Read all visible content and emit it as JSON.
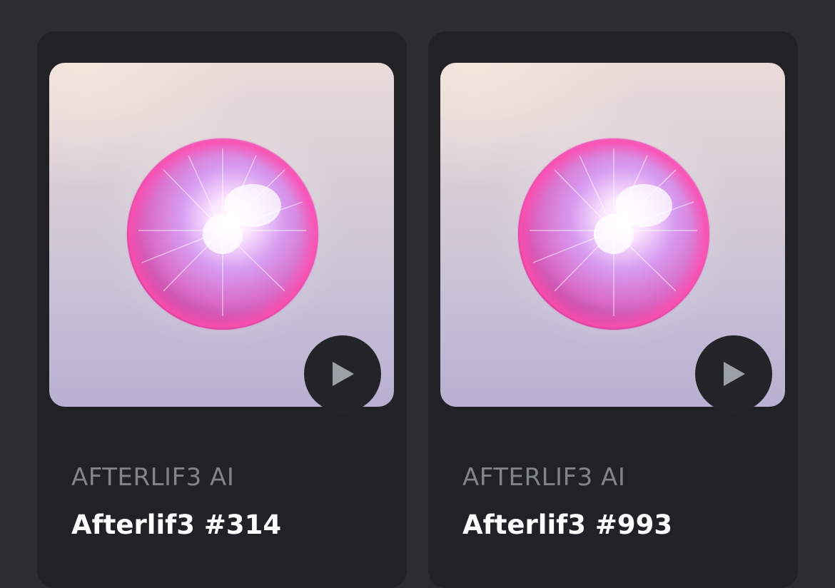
{
  "cards": [
    {
      "collection": "AFTERLIF3 AI",
      "name": "Afterlif3 #314",
      "media_alt": "Pink glowing orb artwork",
      "play_icon": "play-icon"
    },
    {
      "collection": "AFTERLIF3 AI",
      "name": "Afterlif3 #993",
      "media_alt": "Pink glowing orb artwork",
      "play_icon": "play-icon"
    }
  ],
  "colors": {
    "page_background": "#2a2d32",
    "card_background": "#202226",
    "collection_text": "#7f858b",
    "name_text": "#ffffff",
    "orb_pink": "#e05ab8",
    "play_button": "#222428",
    "play_triangle": "#9aa0a6"
  }
}
